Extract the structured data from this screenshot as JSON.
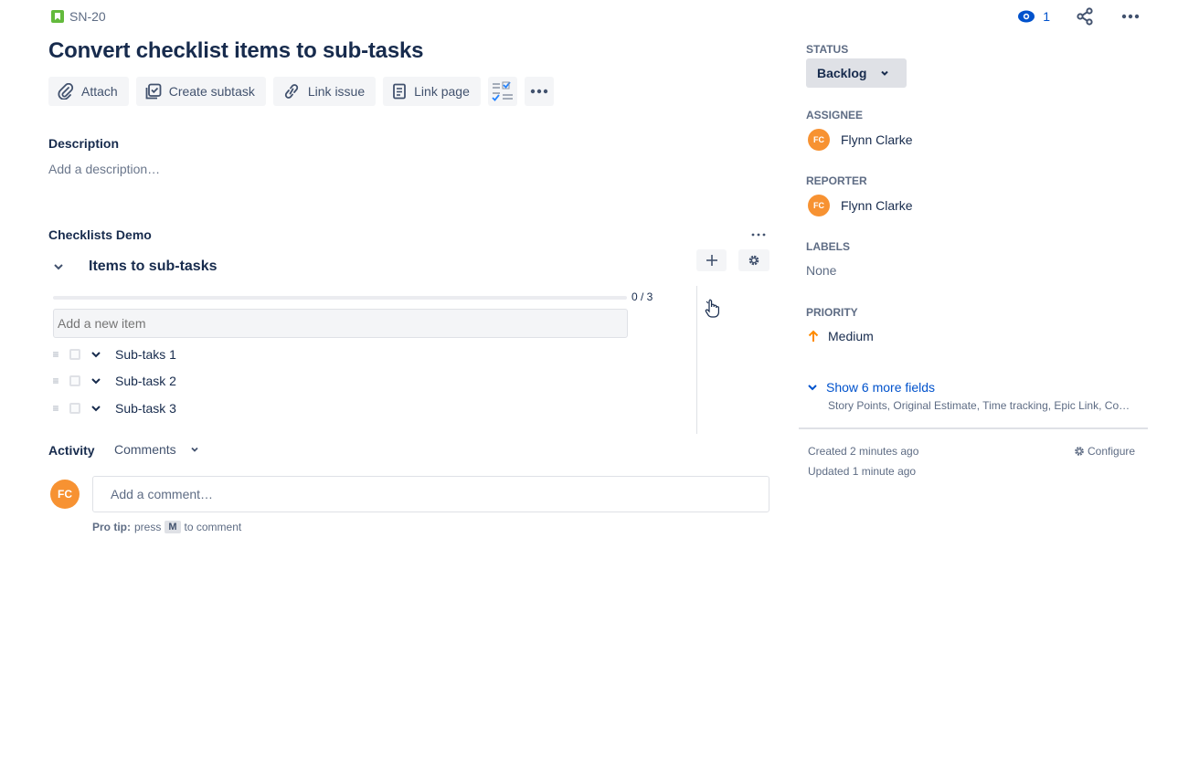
{
  "issue": {
    "key": "SN-20",
    "title": "Convert checklist items to sub-tasks",
    "watchers_count": "1"
  },
  "toolbar": {
    "attach": "Attach",
    "create_subtask": "Create subtask",
    "link_issue": "Link issue",
    "link_page": "Link page"
  },
  "description": {
    "label": "Description",
    "placeholder": "Add a description…"
  },
  "checklist": {
    "section_title": "Checklists Demo",
    "name": "Items to sub-tasks",
    "progress_text": "0 / 3",
    "progress_fraction": 0,
    "new_item_placeholder": "Add a new item",
    "items": [
      {
        "label": "Sub-taks 1",
        "checked": false
      },
      {
        "label": "Sub-task 2",
        "checked": false
      },
      {
        "label": "Sub-task 3",
        "checked": false
      }
    ]
  },
  "activity": {
    "label": "Activity",
    "filter": "Comments",
    "avatar_initials": "FC",
    "comment_placeholder": "Add a comment…",
    "protip_lead": "Pro tip:",
    "protip_press": "press",
    "protip_key": "M",
    "protip_tail": "to comment"
  },
  "sidebar": {
    "status_label": "STATUS",
    "status_value": "Backlog",
    "assignee_label": "ASSIGNEE",
    "assignee_initials": "FC",
    "assignee_name": "Flynn Clarke",
    "reporter_label": "REPORTER",
    "reporter_initials": "FC",
    "reporter_name": "Flynn Clarke",
    "labels_label": "LABELS",
    "labels_value": "None",
    "priority_label": "PRIORITY",
    "priority_value": "Medium",
    "more_fields": "Show 6 more fields",
    "more_fields_sub": "Story Points, Original Estimate, Time tracking, Epic Link, Co…",
    "created": "Created 2 minutes ago",
    "updated": "Updated 1 minute ago",
    "configure": "Configure"
  },
  "colors": {
    "accent": "#0052CC",
    "story": "#63BA3C",
    "avatar": "#F79232",
    "priority_medium": "#FF8B00"
  },
  "icons": [
    "story-icon",
    "eye-icon",
    "share-icon",
    "more-icon",
    "paperclip-icon",
    "subtask-icon",
    "link-icon",
    "page-icon",
    "checklist-icon",
    "plus-icon",
    "gear-icon",
    "chevron-down-icon",
    "drag-handle-icon",
    "arrow-up-icon",
    "hand-cursor-icon"
  ]
}
